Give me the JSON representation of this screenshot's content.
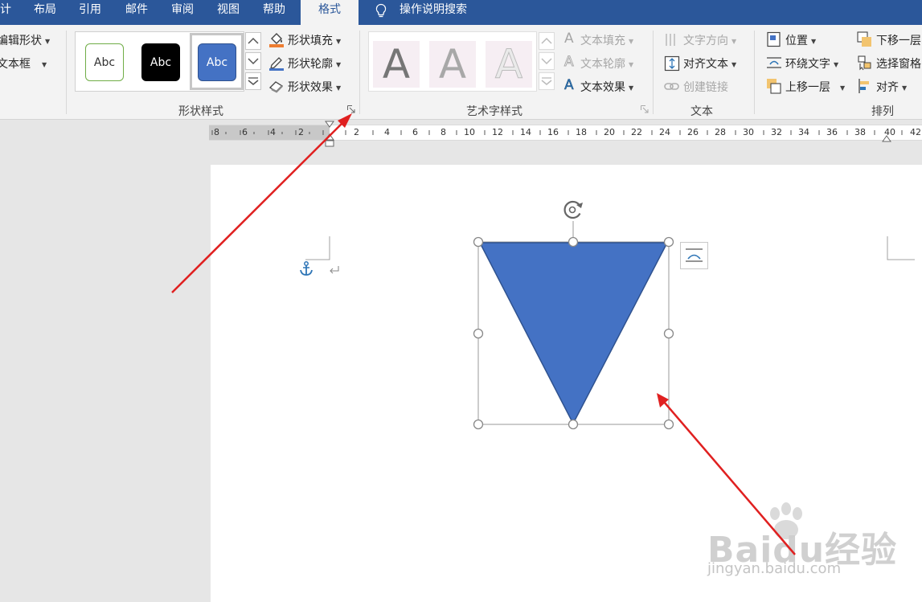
{
  "tabs": [
    "计",
    "布局",
    "引用",
    "邮件",
    "审阅",
    "视图",
    "帮助",
    "格式"
  ],
  "search_label": "操作说明搜索",
  "insert_shapes": {
    "edit_shape": "编辑形状",
    "text_box": "文本框"
  },
  "shape_styles": {
    "swatches": [
      "Abc",
      "Abc",
      "Abc"
    ],
    "fill": "形状填充",
    "outline": "形状轮廓",
    "effects": "形状效果",
    "group_label": "形状样式"
  },
  "wordart": {
    "letters": [
      "A",
      "A",
      "A"
    ],
    "text_fill": "文本填充",
    "text_outline": "文本轮廓",
    "text_effects": "文本效果",
    "group_label": "艺术字样式"
  },
  "text_group": {
    "direction": "文字方向",
    "align": "对齐文本",
    "link": "创建链接",
    "group_label": "文本"
  },
  "arrange": {
    "position": "位置",
    "wrap": "环绕文字",
    "bring_forward": "上移一层",
    "send_backward": "下移一层",
    "selection_pane": "选择窗格",
    "align": "对齐",
    "group_label": "排列"
  },
  "ruler_labels": [
    "8",
    "6",
    "4",
    "2",
    "2",
    "4",
    "6",
    "8",
    "10",
    "12",
    "14",
    "16",
    "18",
    "20",
    "22",
    "24",
    "26",
    "28",
    "30",
    "32",
    "34",
    "36",
    "38",
    "40",
    "42"
  ],
  "watermark": {
    "logo": "Baidu经验",
    "url": "jingyan.baidu.com"
  },
  "colors": {
    "title_bar": "#2b579a",
    "ribbon_bg": "#f3f3f3",
    "shape_fill": "#4472c4",
    "shape_stroke": "#2f528f",
    "annotation_arrow": "#e02020"
  },
  "icons": [
    "lightbulb-icon",
    "paint-bucket-icon",
    "pen-outline-icon",
    "shape-effects-icon",
    "text-direction-icon",
    "align-text-icon",
    "link-icon",
    "position-icon",
    "wrap-text-icon",
    "bring-forward-icon",
    "send-backward-icon",
    "selection-pane-icon",
    "align-icon",
    "anchor-icon",
    "paragraph-mark-icon",
    "rotate-handle-icon",
    "layout-options-icon"
  ]
}
